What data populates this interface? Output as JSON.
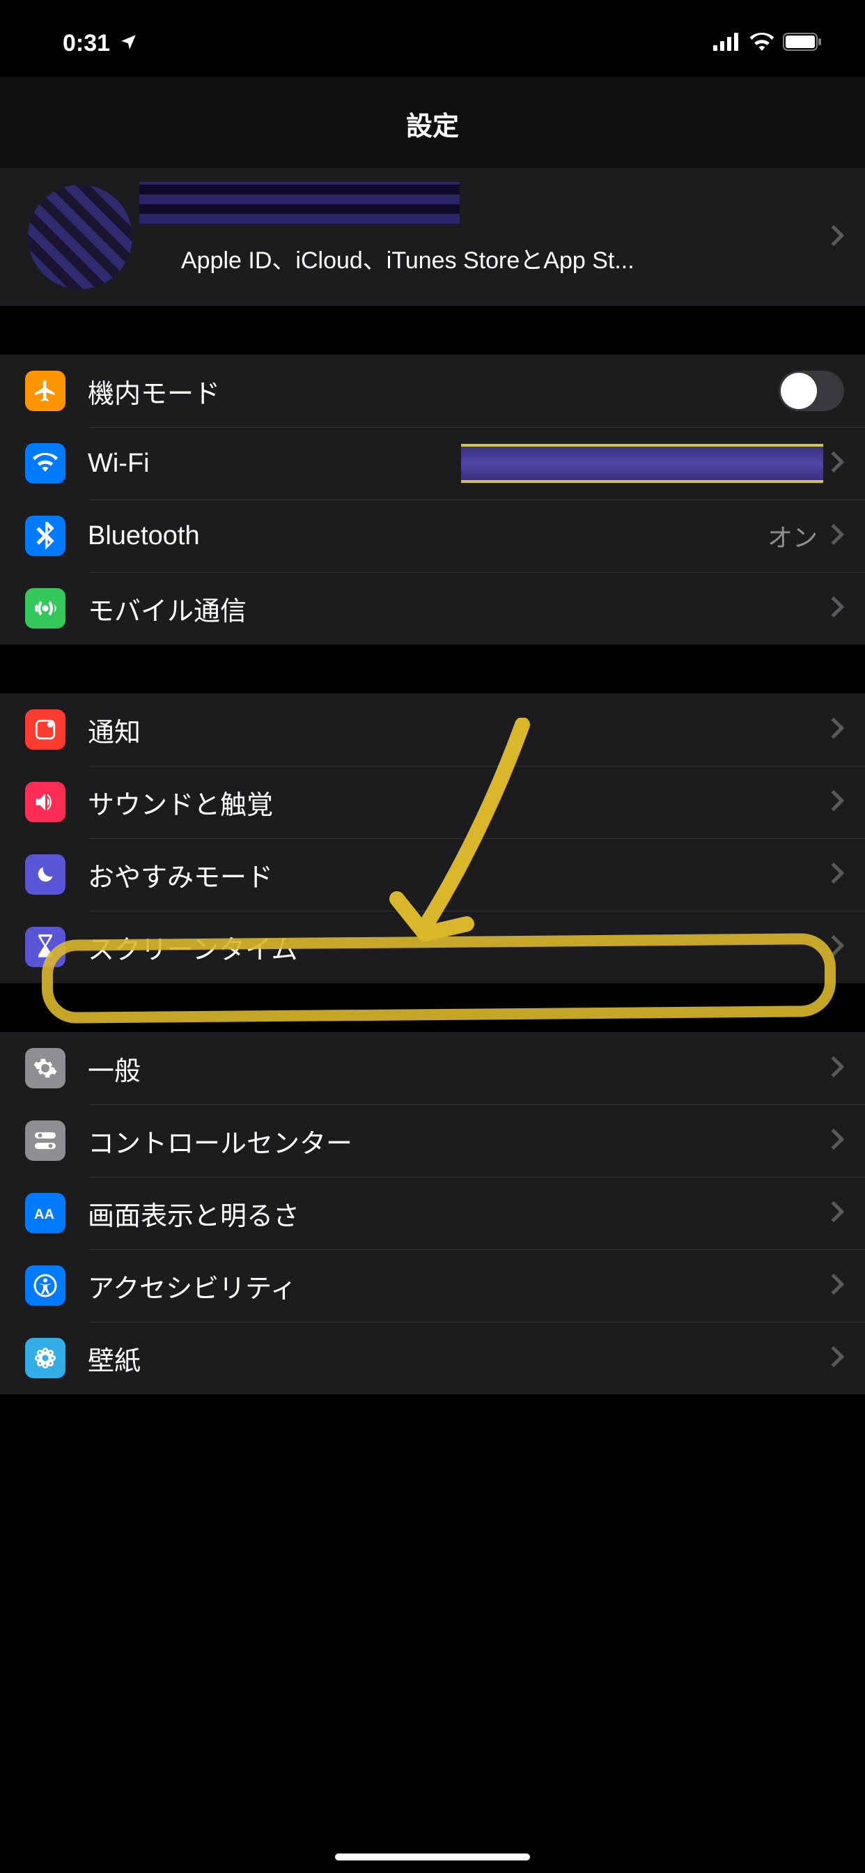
{
  "status": {
    "time": "0:31",
    "location_icon": "location-arrow-icon"
  },
  "title": "設定",
  "apple_id": {
    "subtitle": "Apple ID、iCloud、iTunes StoreとApp St..."
  },
  "group1": {
    "airplane": "機内モード",
    "wifi": "Wi-Fi",
    "bluetooth": "Bluetooth",
    "bluetooth_value": "オン",
    "cellular": "モバイル通信"
  },
  "group2": {
    "notifications": "通知",
    "sounds": "サウンドと触覚",
    "dnd": "おやすみモード",
    "screentime": "スクリーンタイム"
  },
  "group3": {
    "general": "一般",
    "control_center": "コントロールセンター",
    "display": "画面表示と明るさ",
    "accessibility": "アクセシビリティ",
    "wallpaper": "壁紙"
  },
  "colors": {
    "orange": "#ff9500",
    "blue": "#007aff",
    "green": "#34c759",
    "red": "#ff3b30",
    "pink": "#ff2d55",
    "indigo": "#5856d6",
    "gray": "#8e8e93",
    "cyan": "#32ade6"
  }
}
